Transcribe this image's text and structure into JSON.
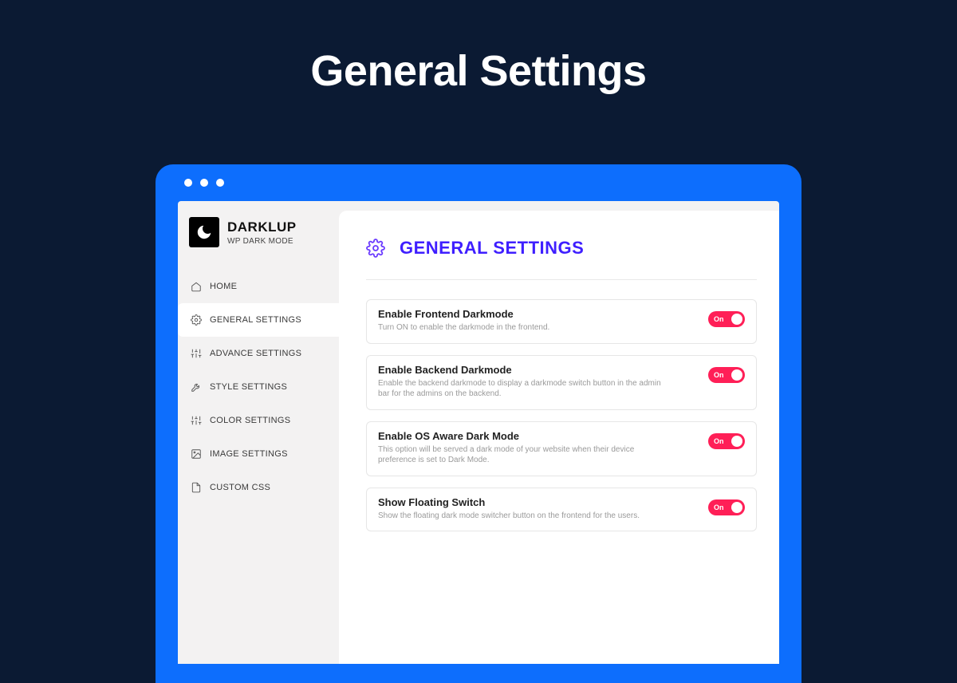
{
  "hero_title": "General Settings",
  "brand": {
    "name": "DARKLUP",
    "subtitle": "WP DARK MODE"
  },
  "nav": {
    "items": [
      {
        "label": "HOME"
      },
      {
        "label": "GENERAL SETTINGS"
      },
      {
        "label": "ADVANCE SETTINGS"
      },
      {
        "label": "STYLE SETTINGS"
      },
      {
        "label": "COLOR SETTINGS"
      },
      {
        "label": "IMAGE SETTINGS"
      },
      {
        "label": "CUSTOM CSS"
      }
    ],
    "active_index": 1
  },
  "panel": {
    "title": "GENERAL SETTINGS"
  },
  "toggle_on_label": "On",
  "settings": [
    {
      "title": "Enable Frontend Darkmode",
      "description": "Turn ON to enable the darkmode in the frontend.",
      "state": "on"
    },
    {
      "title": "Enable Backend Darkmode",
      "description": "Enable the backend darkmode to display a darkmode switch button in the admin bar for the admins on the backend.",
      "state": "on"
    },
    {
      "title": "Enable OS Aware Dark Mode",
      "description": "This option will be served a dark mode of your website when their device preference is set to Dark Mode.",
      "state": "on"
    },
    {
      "title": "Show Floating Switch",
      "description": "Show the floating dark mode switcher button on the frontend for the users.",
      "state": "on"
    }
  ],
  "colors": {
    "page_bg": "#0b1a33",
    "window_bg": "#0d6efd",
    "accent": "#3f1fff",
    "toggle_on": "#ff1f57"
  }
}
